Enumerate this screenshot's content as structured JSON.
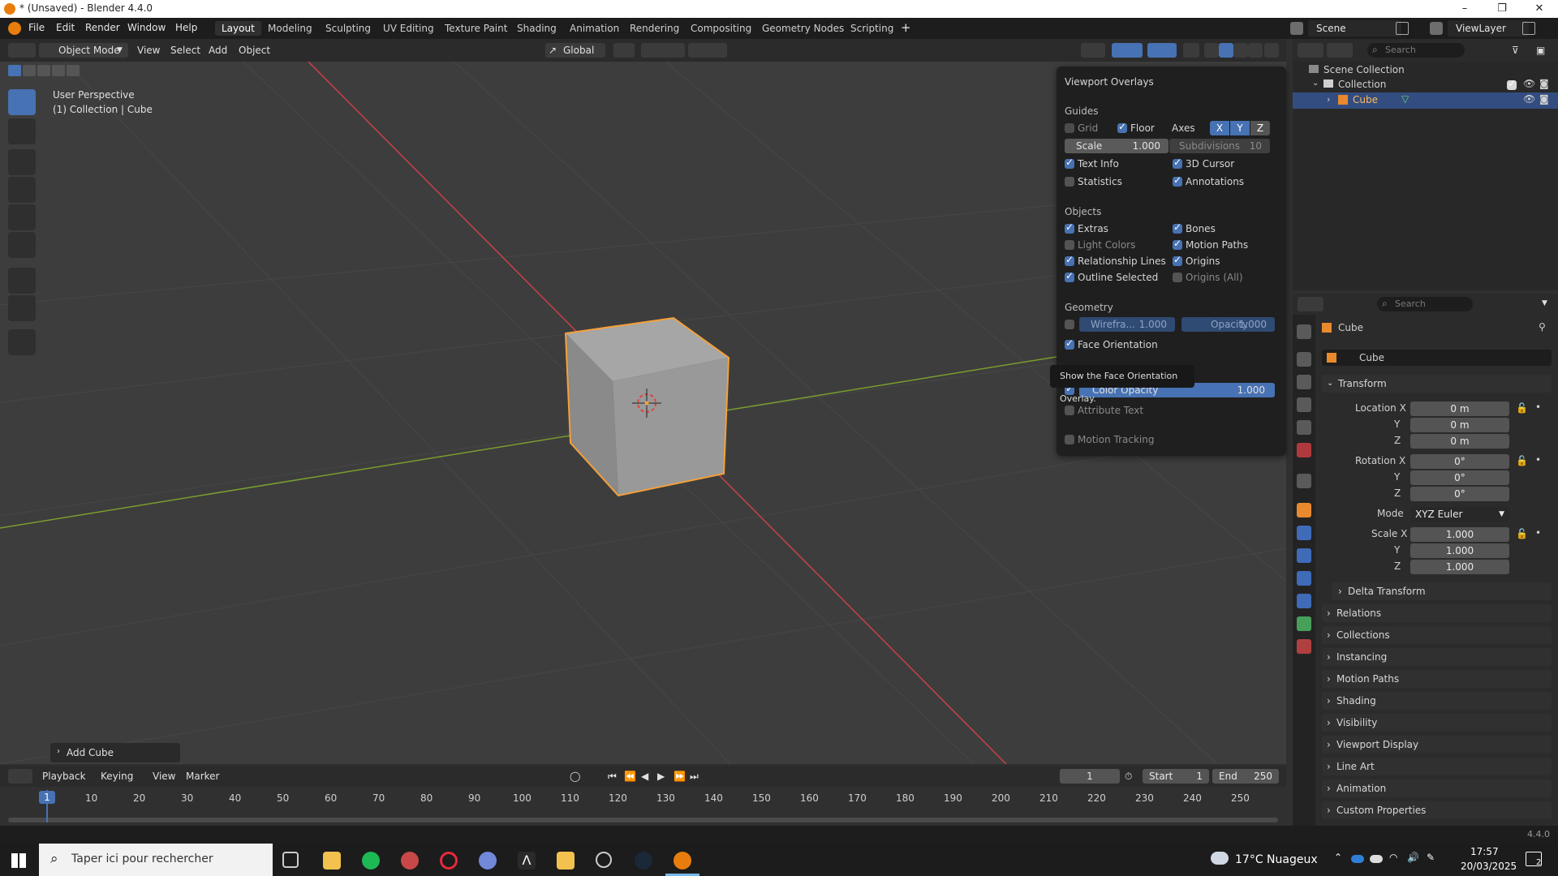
{
  "titlebar": {
    "title": "* (Unsaved) - Blender 4.4.0"
  },
  "menu": [
    "File",
    "Edit",
    "Render",
    "Window",
    "Help"
  ],
  "workspaces": [
    "Layout",
    "Modeling",
    "Sculpting",
    "UV Editing",
    "Texture Paint",
    "Shading",
    "Animation",
    "Rendering",
    "Compositing",
    "Geometry Nodes",
    "Scripting"
  ],
  "active_workspace": "Layout",
  "scene": {
    "name": "Scene",
    "view_layer": "ViewLayer"
  },
  "viewport_header": {
    "mode": "Object Mode",
    "menus": [
      "View",
      "Select",
      "Add",
      "Object"
    ],
    "orientation": "Global"
  },
  "viewport_text": {
    "perspective": "User Perspective",
    "collection": "(1) Collection | Cube"
  },
  "last_op": "Add Cube",
  "overlays": {
    "title": "Viewport Overlays",
    "guides": {
      "heading": "Guides",
      "grid": "Grid",
      "floor": "Floor",
      "axes": "Axes",
      "axis_x": "X",
      "axis_y": "Y",
      "axis_z": "Z",
      "scale_label": "Scale",
      "scale_value": "1.000",
      "subdiv_label": "Subdivisions",
      "subdiv_value": "10",
      "text_info": "Text Info",
      "cursor": "3D Cursor",
      "statistics": "Statistics",
      "annotations": "Annotations"
    },
    "objects": {
      "heading": "Objects",
      "extras": "Extras",
      "bones": "Bones",
      "light_colors": "Light Colors",
      "motion_paths": "Motion Paths",
      "relationship_lines": "Relationship Lines",
      "origins": "Origins",
      "outline_selected": "Outline Selected",
      "origins_all": "Origins (All)"
    },
    "geometry": {
      "heading": "Geometry",
      "wireframe_label": "Wirefra...",
      "wireframe_value": "1.000",
      "opacity_label": "Opacity",
      "opacity_value": "1.000",
      "face_orientation": "Face Orientation",
      "color_opacity_label": "Color Opacity",
      "color_opacity_value": "1.000",
      "attribute_text": "Attribute Text",
      "motion_tracking": "Motion Tracking"
    }
  },
  "tooltip": "Show the Face Orientation Overlay.",
  "outliner": {
    "search_placeholder": "Search",
    "scene_collection": "Scene Collection",
    "collection": "Collection",
    "cube": "Cube"
  },
  "properties": {
    "search_placeholder": "Search",
    "object_name": "Cube",
    "object_field": "Cube",
    "transform": "Transform",
    "location_x_label": "Location X",
    "location_x": "0 m",
    "location_y_label": "Y",
    "location_y": "0 m",
    "location_z_label": "Z",
    "location_z": "0 m",
    "rotation_x_label": "Rotation X",
    "rotation_x": "0°",
    "rotation_y_label": "Y",
    "rotation_y": "0°",
    "rotation_z_label": "Z",
    "rotation_z": "0°",
    "mode_label": "Mode",
    "mode_value": "XYZ Euler",
    "scale_x_label": "Scale X",
    "scale_x": "1.000",
    "scale_y_label": "Y",
    "scale_y": "1.000",
    "scale_z_label": "Z",
    "scale_z": "1.000",
    "delta_transform": "Delta Transform",
    "panels": [
      "Relations",
      "Collections",
      "Instancing",
      "Motion Paths",
      "Shading",
      "Visibility",
      "Viewport Display",
      "Line Art",
      "Animation",
      "Custom Properties"
    ]
  },
  "timeline": {
    "menus": [
      "Playback",
      "Keying",
      "View",
      "Marker"
    ],
    "current_frame": "1",
    "start_label": "Start",
    "start": "1",
    "end_label": "End",
    "end": "250",
    "ticks": [
      "1",
      "10",
      "20",
      "30",
      "40",
      "50",
      "60",
      "70",
      "80",
      "90",
      "100",
      "110",
      "120",
      "130",
      "140",
      "150",
      "160",
      "170",
      "180",
      "190",
      "200",
      "210",
      "220",
      "230",
      "240",
      "250"
    ]
  },
  "version": "4.4.0",
  "taskbar": {
    "search_placeholder": "Taper ici pour rechercher",
    "weather": "17°C  Nuageux",
    "time": "17:57",
    "date": "20/03/2025",
    "notifications": "2"
  },
  "colors": {
    "accent": "#4772b3",
    "selection_outline": "#f5a03a",
    "x_axis": "#c9404a",
    "y_axis": "#7a9e2e"
  }
}
